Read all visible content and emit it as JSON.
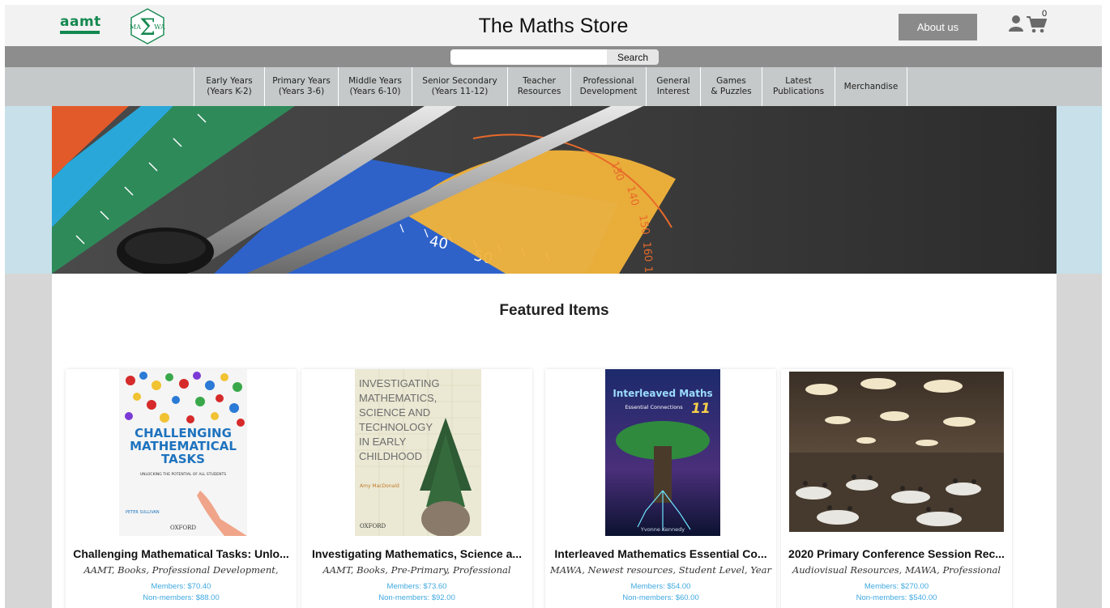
{
  "header": {
    "logo_aamt": "aamt",
    "logo_mawa": "MAWA",
    "title": "The Maths Store",
    "about_label": "About us",
    "cart_count": "0"
  },
  "search": {
    "placeholder": "",
    "button_label": "Search"
  },
  "categories": [
    {
      "label": "Early Years\n(Years K-2)"
    },
    {
      "label": "Primary Years\n(Years 3-6)"
    },
    {
      "label": "Middle Years\n(Years 6-10)"
    },
    {
      "label": "Senior Secondary\n(Years 11-12)"
    },
    {
      "label": "Teacher\nResources"
    },
    {
      "label": "Professional\nDevelopment"
    },
    {
      "label": "General\nInterest"
    },
    {
      "label": "Games\n& Puzzles"
    },
    {
      "label": "Latest\nPublications"
    },
    {
      "label": "Merchandise"
    }
  ],
  "featured": {
    "title": "Featured Items",
    "items": [
      {
        "title": "Challenging Mathematical Tasks: Unlo...",
        "categories": "AAMT, Books, Professional Development,",
        "members_price": "Members: $70.40",
        "nonmembers_price": "Non-members: $88.00",
        "cover_lines": [
          "CHALLENGING",
          "MATHEMATICAL",
          "TASKS"
        ],
        "cover_sub": "UNLOCKING THE POTENTIAL OF ALL STUDENTS",
        "cover_author": "PETER SULLIVAN",
        "cover_publisher": "OXFORD"
      },
      {
        "title": "Investigating Mathematics, Science a...",
        "categories": "AAMT, Books, Pre-Primary, Professional",
        "members_price": "Members: $73.60",
        "nonmembers_price": "Non-members: $92.00",
        "cover_lines": [
          "INVESTIGATING",
          "MATHEMATICS,",
          "SCIENCE AND",
          "TECHNOLOGY",
          "IN EARLY",
          "CHILDHOOD"
        ],
        "cover_author": "Amy MacDonald",
        "cover_publisher": "OXFORD"
      },
      {
        "title": "Interleaved Mathematics Essential Co...",
        "categories": "MAWA, Newest resources, Student Level, Year",
        "members_price": "Members: $54.00",
        "nonmembers_price": "Non-members: $60.00",
        "cover_lines": [
          "Interleaved Maths",
          "Essential Connections"
        ],
        "cover_number": "11",
        "cover_author": "Yvonne Kennedy"
      },
      {
        "title": "2020 Primary Conference Session Rec...",
        "categories": "Audiovisual Resources, MAWA, Professional",
        "members_price": "Members: $270.00",
        "nonmembers_price": "Non-members: $540.00"
      }
    ]
  }
}
